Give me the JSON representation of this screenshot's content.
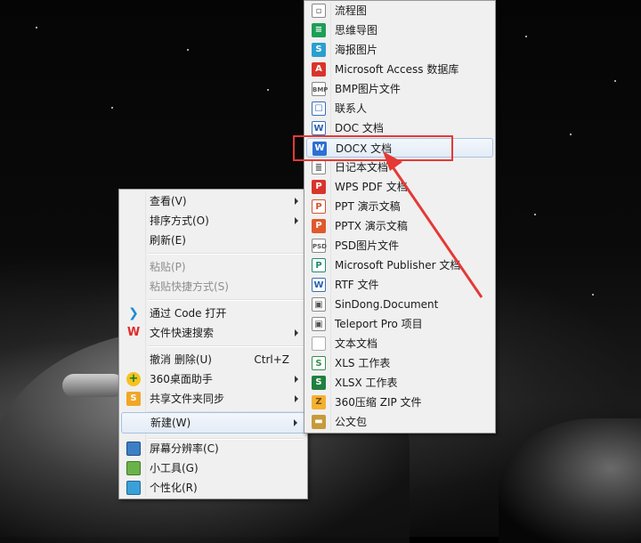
{
  "context_menu": {
    "items": [
      {
        "label": "查看(V)",
        "submenu": true
      },
      {
        "label": "排序方式(O)",
        "submenu": true
      },
      {
        "label": "刷新(E)"
      },
      {
        "label": "粘贴(P)",
        "disabled": true
      },
      {
        "label": "粘贴快捷方式(S)",
        "disabled": true
      },
      {
        "label": "通过 Code 打开",
        "icon": "vscode-icon"
      },
      {
        "label": "文件快速搜索",
        "icon": "wps-icon",
        "submenu": true
      },
      {
        "label": "撤消 删除(U)",
        "shortcut": "Ctrl+Z"
      },
      {
        "label": "360桌面助手",
        "icon": "360-icon",
        "submenu": true
      },
      {
        "label": "共享文件夹同步",
        "icon": "sync-icon",
        "submenu": true
      },
      {
        "label": "新建(W)",
        "submenu": true,
        "highlighted": true
      },
      {
        "label": "屏幕分辨率(C)",
        "icon": "monitor-icon"
      },
      {
        "label": "小工具(G)",
        "icon": "gadgets-icon"
      },
      {
        "label": "个性化(R)",
        "icon": "personalize-icon"
      }
    ]
  },
  "new_submenu": {
    "items": [
      {
        "label": "流程图",
        "icon": "flowchart-icon"
      },
      {
        "label": "思维导图",
        "icon": "mindmap-icon"
      },
      {
        "label": "海报图片",
        "icon": "poster-icon"
      },
      {
        "label": "Microsoft Access 数据库",
        "icon": "access-icon"
      },
      {
        "label": "BMP图片文件",
        "icon": "bmp-icon"
      },
      {
        "label": "联系人",
        "icon": "contact-icon"
      },
      {
        "label": "DOC 文档",
        "icon": "doc-icon"
      },
      {
        "label": "DOCX 文档",
        "icon": "docx-icon",
        "highlighted": true
      },
      {
        "label": "日记本文档",
        "icon": "journal-icon"
      },
      {
        "label": "WPS PDF 文档",
        "icon": "pdf-icon"
      },
      {
        "label": "PPT 演示文稿",
        "icon": "ppt-icon"
      },
      {
        "label": "PPTX 演示文稿",
        "icon": "pptx-icon"
      },
      {
        "label": "PSD图片文件",
        "icon": "psd-icon"
      },
      {
        "label": "Microsoft Publisher 文档",
        "icon": "publisher-icon"
      },
      {
        "label": "RTF 文件",
        "icon": "rtf-icon"
      },
      {
        "label": "SinDong.Document",
        "icon": "sindong-icon"
      },
      {
        "label": "Teleport Pro 项目",
        "icon": "teleport-icon"
      },
      {
        "label": "文本文档",
        "icon": "text-file-icon"
      },
      {
        "label": "XLS 工作表",
        "icon": "xls-icon"
      },
      {
        "label": "XLSX 工作表",
        "icon": "xlsx-icon"
      },
      {
        "label": "360压缩 ZIP 文件",
        "icon": "zip-icon"
      },
      {
        "label": "公文包",
        "icon": "briefcase-icon"
      }
    ]
  },
  "annotation": {
    "color": "#e53935"
  }
}
